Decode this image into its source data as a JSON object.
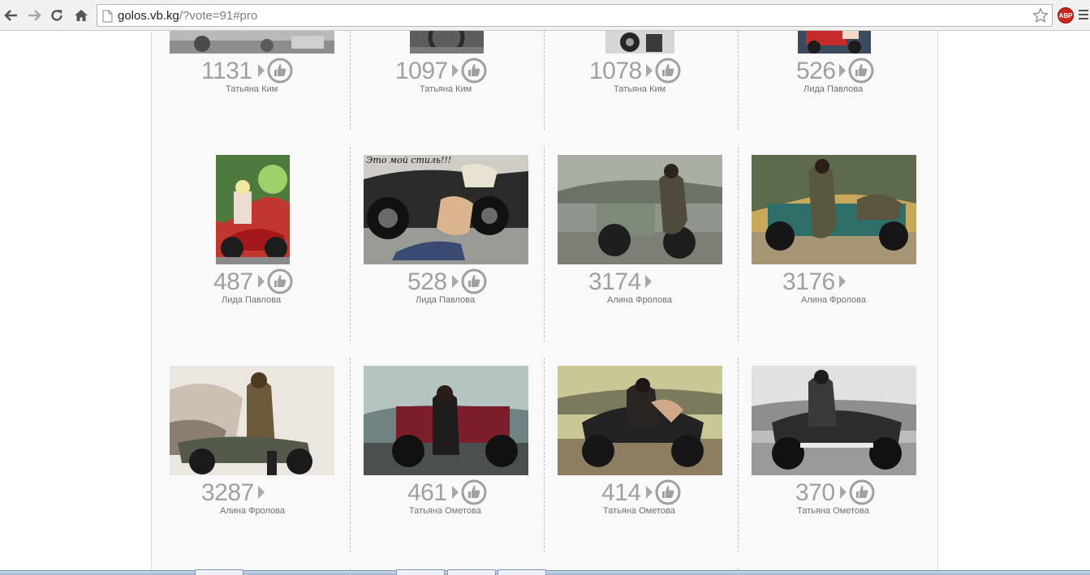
{
  "browser": {
    "url_host": "golos.vb.kg",
    "url_path": "/?vote=91#pro",
    "abp_label": "ABP",
    "icons": [
      "back-arrow-icon",
      "forward-arrow-icon",
      "reload-icon",
      "home-icon",
      "page-icon",
      "star-icon",
      "adblock-icon",
      "menu-icon"
    ]
  },
  "colors": {
    "count": "#a0a0a0",
    "author": "#6f6f6f",
    "background": "#f9f9f9",
    "separator": "#bdbdbd"
  },
  "entries": [
    {
      "count": "1131",
      "author": "Татьяна Ким",
      "like_icon": true
    },
    {
      "count": "1097",
      "author": "Татьяна Ким",
      "like_icon": true
    },
    {
      "count": "1078",
      "author": "Татьяна Ким",
      "like_icon": true
    },
    {
      "count": "526",
      "author": "Лида Павлова",
      "like_icon": true
    },
    {
      "count": "487",
      "author": "Лида Павлова",
      "like_icon": true
    },
    {
      "count": "528",
      "author": "Лида Павлова",
      "like_icon": true,
      "photo_caption": "Это мой стиль!!!"
    },
    {
      "count": "3174",
      "author": "Алина Фролова",
      "like_icon": false
    },
    {
      "count": "3176",
      "author": "Алина Фролова",
      "like_icon": false
    },
    {
      "count": "3287",
      "author": "Алина Фролова",
      "like_icon": false
    },
    {
      "count": "461",
      "author": "Татьяна Ометова",
      "like_icon": true
    },
    {
      "count": "414",
      "author": "Татьяна Ометова",
      "like_icon": true
    },
    {
      "count": "370",
      "author": "Татьяна Ометова",
      "like_icon": true
    }
  ]
}
